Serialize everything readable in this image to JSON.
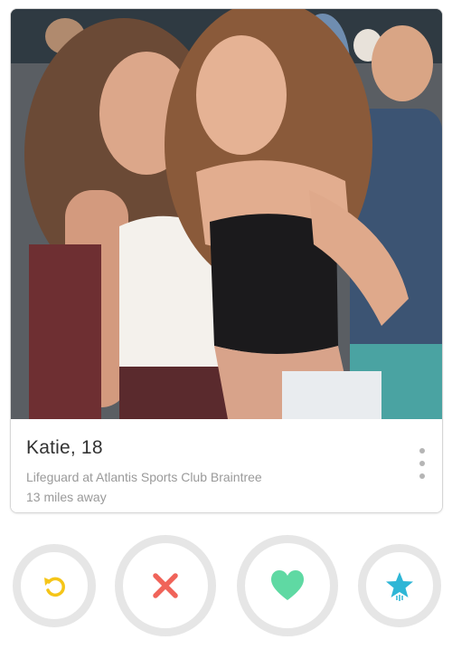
{
  "profile": {
    "name_age": "Katie, 18",
    "job": "Lifeguard at Atlantis Sports Club Braintree",
    "distance": "13 miles away"
  },
  "actions": {
    "rewind": {
      "icon": "rewind-icon",
      "color": "#f5c518"
    },
    "nope": {
      "icon": "close-icon",
      "color": "#f0645a"
    },
    "like": {
      "icon": "heart-icon",
      "color": "#5fd9a3"
    },
    "super_like": {
      "icon": "star-icon",
      "color": "#2eb6d6"
    }
  },
  "photo": {
    "icon": "profile-photo"
  }
}
